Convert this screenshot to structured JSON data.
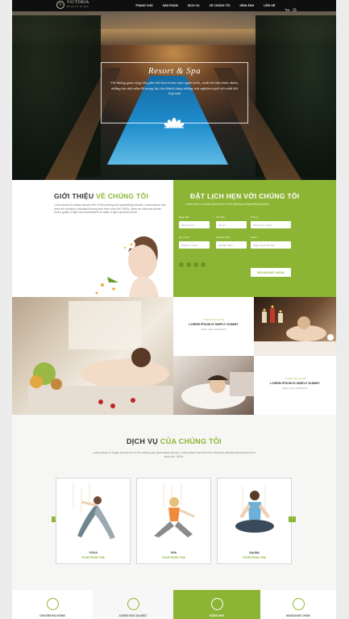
{
  "nav": {
    "brand": "VICTORIA",
    "brand_sub": "BEAUTY & SPA",
    "menu": [
      "TRANG CHỦ",
      "SẢN PHẨM",
      "DỊCH VỤ",
      "VỀ CHÚNG TÔI",
      "HÌNH ẢNH",
      "LIÊN HỆ"
    ]
  },
  "hero": {
    "title": "Resort & Spa",
    "text": "Với không gian rộng lớn giữa bãi biển hoàn toàn ngắm biển, cánh bờ nhỏ thiên nhiên, những tòa nhà nằm kề mang lại cho khách hàng những trải nghiệm tuyệt vời nhất khi họp mặt"
  },
  "about": {
    "title_a": "GIỚI THIỆU",
    "title_b": "VỀ CHÚNG TÔI",
    "text": "Lorem Ipsum is simply dummy text of the printing and typesetting industry. Lorem Ipsum has been the industry's standard dummy text ever since the 1500s, when an unknown printer took a galley of type and scrambled it to make a type specimen book."
  },
  "booking": {
    "title": "ĐẶT LỊCH HẸN VỚI CHÚNG TÔI",
    "subtitle": "Lorem Ipsum is simply dummy text of the printing and typesetting industry.",
    "fields": [
      {
        "label": "Ngày đến",
        "placeholder": "dd/mm/yyyy"
      },
      {
        "label": "Giờ đến",
        "placeholder": "hh:mm"
      },
      {
        "label": "Phòng",
        "placeholder": "Phòng tiêu chuẩn"
      },
      {
        "label": "Họ và tên",
        "placeholder": "Nhập họ và tên"
      },
      {
        "label": "Số điện thoại",
        "placeholder": "Số điện thoại"
      },
      {
        "label": "Email",
        "placeholder": "Nhập email của bạn"
      }
    ],
    "button": "BOOKING NOW"
  },
  "gallery": {
    "cards": [
      {
        "category": "Chuyên mục tin tức",
        "title": "LOREM IPSUM IS SIMPLY DUMMY",
        "date": "Đăng ngày 16/09/2019"
      },
      {
        "category": "Chuyên mục tin tức",
        "title": "LOREM IPSUM IS SIMPLY DUMMY",
        "date": "Đăng ngày 16/09/2019"
      }
    ]
  },
  "services": {
    "title_a": "DỊCH VỤ",
    "title_b": "CỦA CHÚNG TÔI",
    "text": "Lorem Ipsum is simply dummy text of the printing and typesetting industry. Lorem Ipsum has been the industry's standard dummy text ever since the 1500s.",
    "items": [
      {
        "name": "YOGA",
        "price": "STAR FROM 720$"
      },
      {
        "name": "SPA",
        "price": "STAR FROM 720$"
      },
      {
        "name": "SAUNA",
        "price": "STAR FROM 720$"
      }
    ]
  },
  "features": [
    {
      "label": "CHƯỜM ĐÁ NÓNG",
      "icon": "stones-icon",
      "active": false
    },
    {
      "label": "CHĂM SÓC DA MẶT",
      "icon": "face-icon",
      "active": false
    },
    {
      "label": "XÔNG HƠI",
      "icon": "steam-icon",
      "active": true
    },
    {
      "label": "MASSAGE CHÂN",
      "icon": "foot-icon",
      "active": false
    }
  ],
  "colors": {
    "accent": "#8db535",
    "nav": "#0f0f0f"
  }
}
